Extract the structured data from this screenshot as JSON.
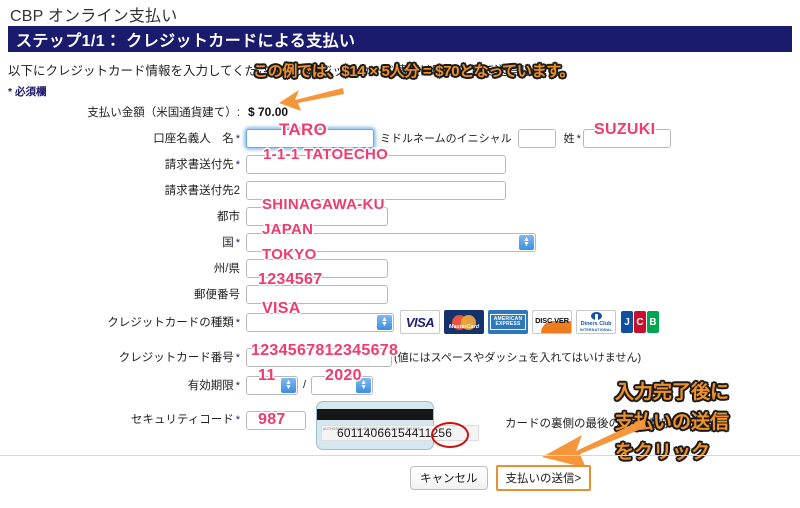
{
  "header": {
    "site_title": "CBP オンライン支払い",
    "step_bar": "ステップ1/1： クレジットカードによる支払い",
    "intro": "以下にクレジットカード情報を入力してください。クレジットカード情報は暗号化して送信します。",
    "required_note": "* 必須欄"
  },
  "form": {
    "amount": {
      "label": "支払い金額（米国通貨建て）:",
      "value": "$ 70.00"
    },
    "account_holder": {
      "label": "口座名義人　名",
      "first_name": "TARO",
      "middle_label": "ミドルネームのイニシャル",
      "middle_initial": "",
      "last_label": "姓",
      "last_name": "SUZUKI"
    },
    "billing_address": {
      "label": "請求書送付先",
      "value": "1-1-1 TATOECHO"
    },
    "billing_address2": {
      "label": "請求書送付先2",
      "value": ""
    },
    "city": {
      "label": "都市",
      "value": "SHINAGAWA-KU"
    },
    "country": {
      "label": "国",
      "value": "JAPAN"
    },
    "state": {
      "label": "州/県",
      "value": "TOKYO"
    },
    "postal": {
      "label": "郵便番号",
      "value": "1234567"
    },
    "card_type": {
      "label": "クレジットカードの種類",
      "value": "VISA"
    },
    "card_number": {
      "label": "クレジットカード番号",
      "value": "1234567812345678",
      "hint": "(値にはスペースやダッシュを入れてはいけません)"
    },
    "expiry": {
      "label": "有効期限",
      "month": "11",
      "separator": "/",
      "year": "2020"
    },
    "security_code": {
      "label": "セキュリティコード",
      "value": "987",
      "note": "カードの裏側の最後の3桁の数字",
      "card_back_number": "60114066154411",
      "card_back_cvv": "256"
    },
    "required_marker": "*"
  },
  "card_logos": [
    {
      "name": "visa",
      "text": "VISA"
    },
    {
      "name": "mastercard",
      "text": "MasterCard"
    },
    {
      "name": "amex",
      "line1": "AMERICAN",
      "line2": "EXPRESS"
    },
    {
      "name": "discover",
      "text": "DISC VER"
    },
    {
      "name": "diners",
      "line1": "Diners Club",
      "line2": "INTERNATIONAL"
    },
    {
      "name": "jcb",
      "j": "J",
      "c": "C",
      "b": "B"
    }
  ],
  "footer": {
    "cancel_label": "キャンセル",
    "submit_label": "支払いの送信>"
  },
  "annotations": {
    "amount_note": "この例では、$14 × 5人分 = $70となっています。",
    "submit_note_line1": "入力完了後に",
    "submit_note_line2": "支払いの送信",
    "submit_note_line3": "をクリック"
  },
  "colors": {
    "header_bar": "#1b1b6e",
    "annotation": "#f09028",
    "handwriting": "#ef3b6e",
    "highlight_border": "#e89030"
  }
}
